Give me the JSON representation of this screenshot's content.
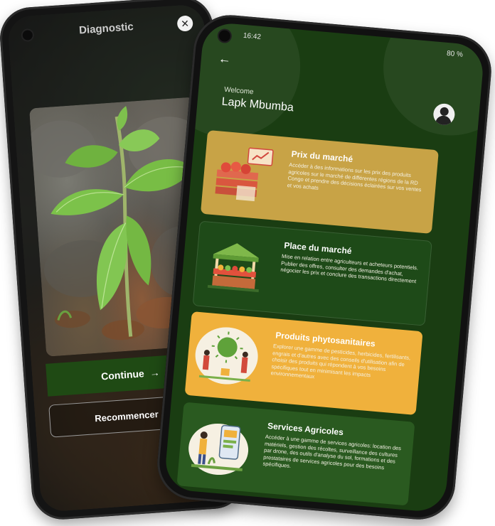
{
  "diagnostic": {
    "title": "Diagnostic",
    "close_icon": "close-icon",
    "continue_label": "Continue",
    "continue_icon": "→",
    "restart_label": "Recommencer",
    "restart_icon": "×"
  },
  "home": {
    "status": {
      "time": "16:42",
      "battery": "80 %"
    },
    "back_icon": "←",
    "welcome_label": "Welcome",
    "user_name": "Lapk Mbumba",
    "cards": [
      {
        "title": "Prix du marché",
        "description": "Accéder à des informations sur les prix des produits agricoles sur le marché de différentes régions de la RD Congo et prendre des décisions éclairées sur vos ventes et vos achats",
        "color": "#c8a346"
      },
      {
        "title": "Place du marché",
        "description": "Mise en relation entre agriculteurs et acheteurs potentiels. Publier des offres, consulter des demandes d'achat, négocier les prix et conclure des transactions directement",
        "color": "#1e4a18"
      },
      {
        "title": "Produits phytosanitaires",
        "description": "Explorer une gamme de pesticides, herbicides, fertilisants, engrais et d'autres avec des conseils d'utilisation afin de choisir des produits qui répondent à vos besoins spécifiques tout en minimisant les impacts environnementaux",
        "color": "#f0b13c"
      },
      {
        "title": "Services Agricoles",
        "description": "Accéder à une gamme de services agricoles: location des matériels, gestion des récoltes, surveillance des cultures par drone, des outils d'analyse du sol, formations et des prestataires de services agricoles pour des besoins spécifiques.",
        "color": "#2a5a20"
      }
    ]
  }
}
